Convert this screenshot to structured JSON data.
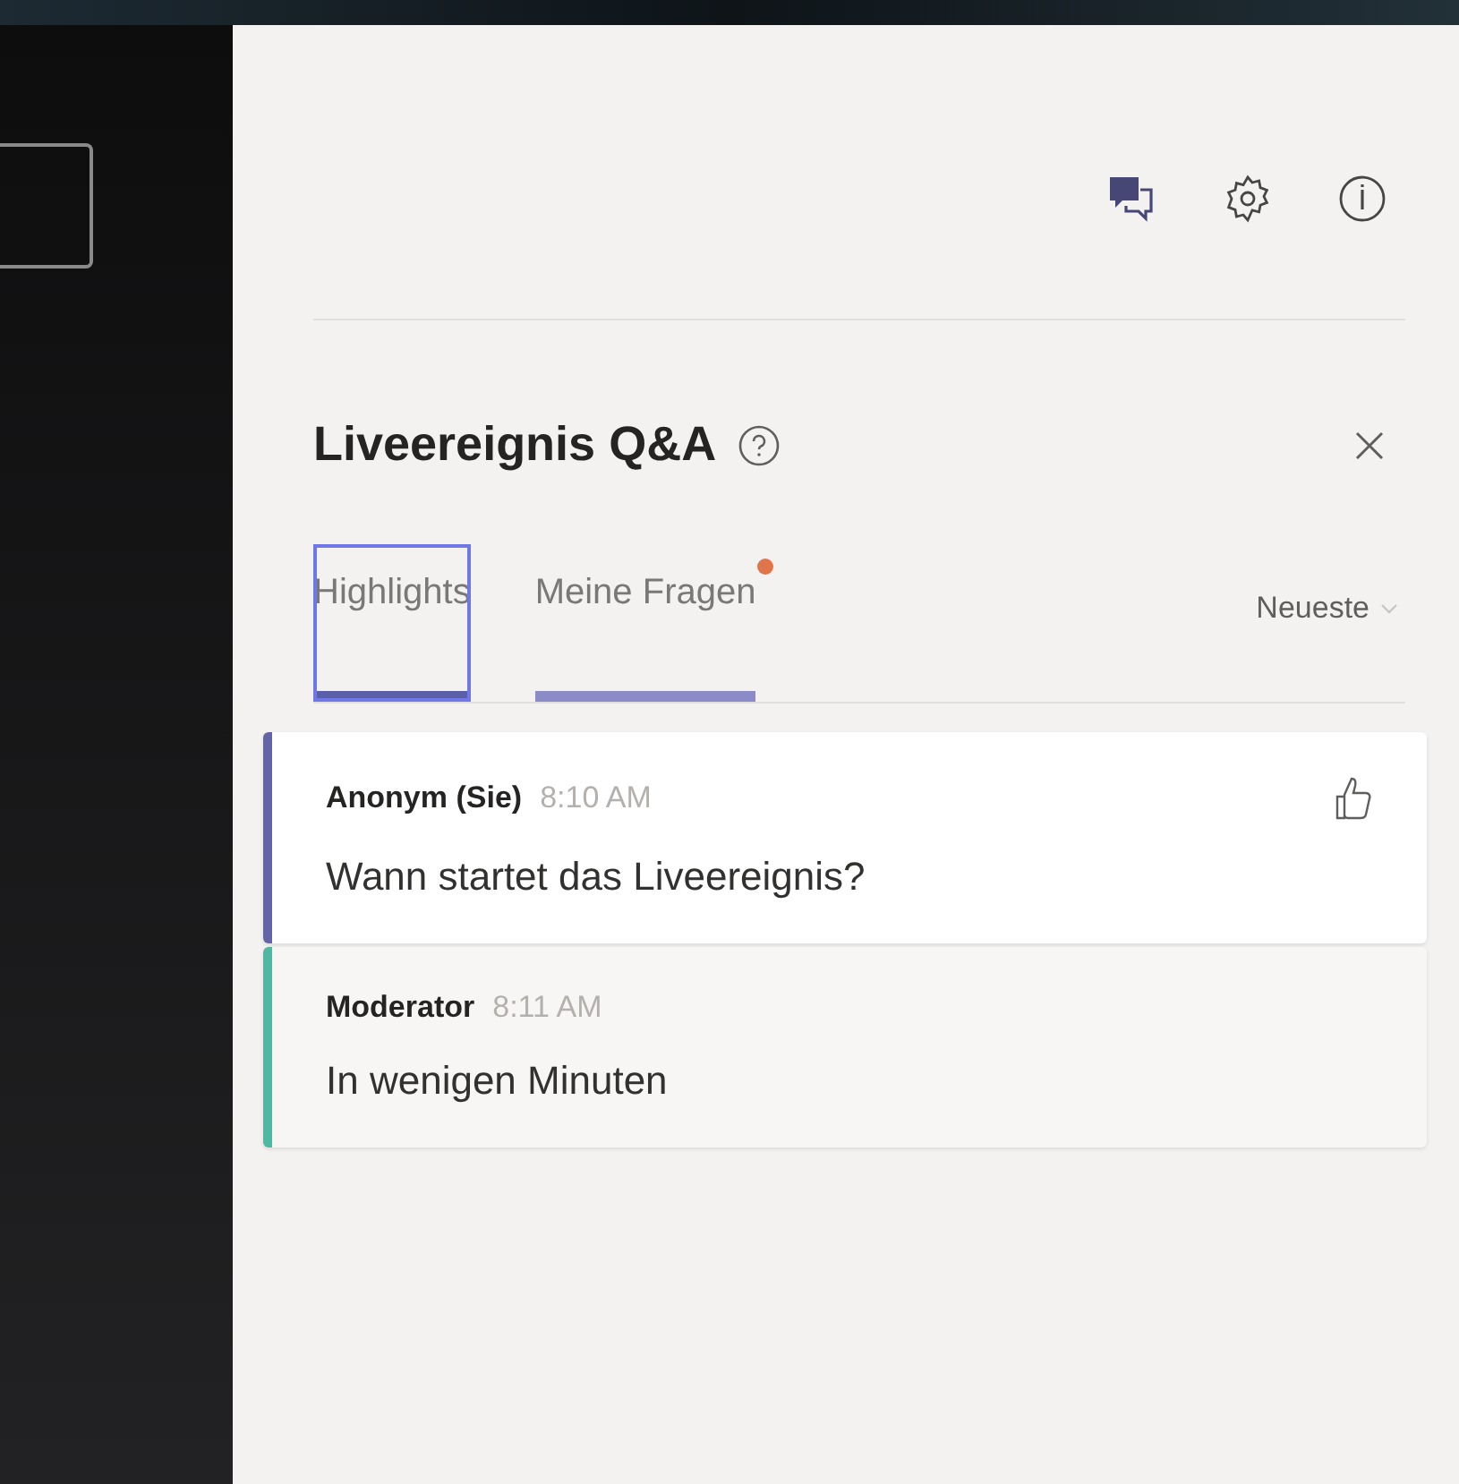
{
  "panel": {
    "title": "Liveereignis Q&A"
  },
  "tabs": [
    {
      "label": "Highlights",
      "selected": true,
      "focused": true,
      "badge": false
    },
    {
      "label": "Meine Fragen",
      "selected": false,
      "focused": false,
      "badge": true
    }
  ],
  "sort": {
    "label": "Neueste"
  },
  "messages": [
    {
      "kind": "question",
      "author": "Anonym (Sie)",
      "time": "8:10 AM",
      "text": "Wann startet das Liveereignis?",
      "color": "#6264a7"
    },
    {
      "kind": "answer",
      "author": "Moderator",
      "time": "8:11 AM",
      "text": "In wenigen Minuten",
      "color": "#4fb8a3"
    }
  ]
}
